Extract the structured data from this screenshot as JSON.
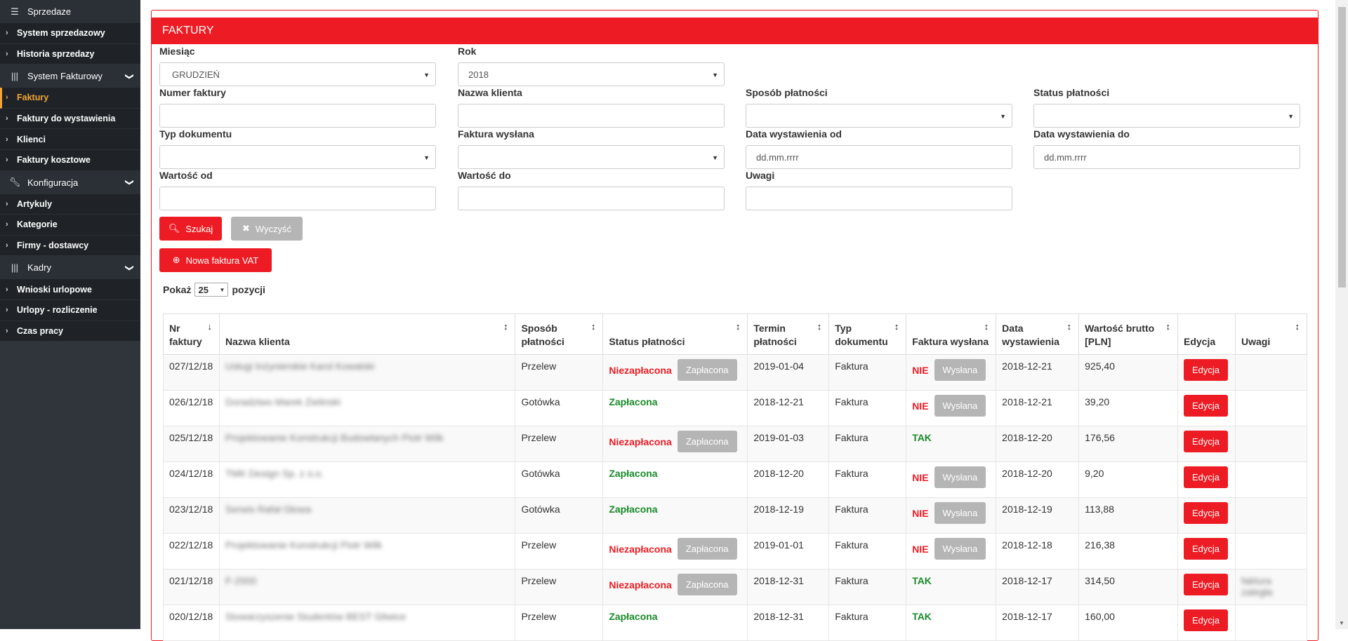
{
  "sidebar": {
    "sections": [
      {
        "title": "Sprzedaze",
        "icon": "list-icon",
        "items": [
          {
            "label": "System sprzedazowy"
          },
          {
            "label": "Historia sprzedazy"
          }
        ]
      },
      {
        "title": "System Fakturowy",
        "icon": "barcode-icon",
        "items": [
          {
            "label": "Faktury"
          },
          {
            "label": "Faktury do wystawienia"
          },
          {
            "label": "Klienci"
          },
          {
            "label": "Faktury kosztowe"
          }
        ]
      },
      {
        "title": "Konfiguracja",
        "icon": "wrench-icon",
        "items": [
          {
            "label": "Artykuly"
          },
          {
            "label": "Kategorie"
          },
          {
            "label": "Firmy - dostawcy"
          }
        ]
      },
      {
        "title": "Kadry",
        "icon": "barcode-icon",
        "items": [
          {
            "label": "Wnioski urlopowe"
          },
          {
            "label": "Urlopy - rozliczenie"
          },
          {
            "label": "Czas pracy"
          }
        ]
      }
    ],
    "active_item": "Faktury"
  },
  "panel": {
    "title": "FAKTURY"
  },
  "filters": {
    "month_label": "Miesiąc",
    "month_value": "GRUDZIEŃ",
    "year_label": "Rok",
    "year_value": "2018",
    "invoice_no_label": "Numer faktury",
    "client_label": "Nazwa klienta",
    "pay_method_label": "Sposób płatności",
    "pay_status_label": "Status płatności",
    "doc_type_label": "Typ dokumentu",
    "sent_label": "Faktura wysłana",
    "date_from_label": "Data wystawienia od",
    "date_from_placeholder": "dd.mm.rrrr",
    "date_to_label": "Data wystawienia do",
    "date_to_placeholder": "dd.mm.rrrr",
    "value_from_label": "Wartość od",
    "value_to_label": "Wartość do",
    "notes_label": "Uwagi"
  },
  "buttons": {
    "search": "Szukaj",
    "clear": "Wyczyść",
    "new_invoice": "Nowa faktura VAT"
  },
  "pagination": {
    "show_label": "Pokaż",
    "page_size": "25",
    "items_label": "pozycji"
  },
  "table": {
    "headers": [
      "Nr faktury",
      "Nazwa klienta",
      "Sposób płatności",
      "Status płatności",
      "Termin płatności",
      "Typ dokumentu",
      "Faktura wysłana",
      "Data wystawienia",
      "Wartość brutto [PLN]",
      "Edycja",
      "Uwagi"
    ],
    "mark_paid_label": "Zapłacona",
    "mark_sent_label": "Wysłana",
    "edit_label": "Edycja",
    "rows": [
      {
        "nr": "027/12/18",
        "client": "Usługi Inżynierskie Karol Kowalski",
        "method": "Przelew",
        "status": "Niezapłacona",
        "due": "2019-01-04",
        "type": "Faktura",
        "sent": "NIE",
        "date": "2018-12-21",
        "value": "925,40",
        "notes": ""
      },
      {
        "nr": "026/12/18",
        "client": "Doradztwo Marek Zielinski",
        "method": "Gotówka",
        "status": "Zapłacona",
        "due": "2018-12-21",
        "type": "Faktura",
        "sent": "NIE",
        "date": "2018-12-21",
        "value": "39,20",
        "notes": ""
      },
      {
        "nr": "025/12/18",
        "client": "Projektowanie Konstrukcji Budowlanych Piotr Wilk",
        "method": "Przelew",
        "status": "Niezapłacona",
        "due": "2019-01-03",
        "type": "Faktura",
        "sent": "TAK",
        "date": "2018-12-20",
        "value": "176,56",
        "notes": ""
      },
      {
        "nr": "024/12/18",
        "client": "TMK Design Sp. z o.o.",
        "method": "Gotówka",
        "status": "Zapłacona",
        "due": "2018-12-20",
        "type": "Faktura",
        "sent": "NIE",
        "date": "2018-12-20",
        "value": "9,20",
        "notes": ""
      },
      {
        "nr": "023/12/18",
        "client": "Serwis Rafał Głowa",
        "method": "Gotówka",
        "status": "Zapłacona",
        "due": "2018-12-19",
        "type": "Faktura",
        "sent": "NIE",
        "date": "2018-12-19",
        "value": "113,88",
        "notes": ""
      },
      {
        "nr": "022/12/18",
        "client": "Projektowanie Konstrukcji Piotr Wilk",
        "method": "Przelew",
        "status": "Niezapłacona",
        "due": "2019-01-01",
        "type": "Faktura",
        "sent": "NIE",
        "date": "2018-12-18",
        "value": "216,38",
        "notes": ""
      },
      {
        "nr": "021/12/18",
        "client": "F-2000",
        "method": "Przelew",
        "status": "Niezapłacona",
        "due": "2018-12-31",
        "type": "Faktura",
        "sent": "TAK",
        "date": "2018-12-17",
        "value": "314,50",
        "notes": "faktura zaległa"
      },
      {
        "nr": "020/12/18",
        "client": "Stowarzyszenie Studentów BEST Gliwice",
        "method": "Przelew",
        "status": "Zapłacona",
        "due": "2018-12-31",
        "type": "Faktura",
        "sent": "TAK",
        "date": "2018-12-17",
        "value": "160,00",
        "notes": ""
      }
    ]
  },
  "colors": {
    "accent": "#ed1c24",
    "sidebar_bg": "#2f353b",
    "active_item": "#f3a537",
    "paid": "#1a8a2a"
  }
}
